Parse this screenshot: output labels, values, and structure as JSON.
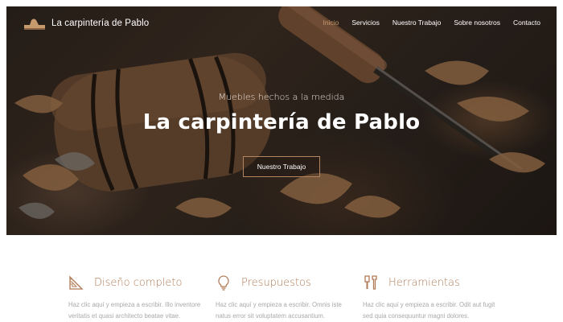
{
  "header": {
    "brand_name": "La carpintería de Pablo",
    "logo_icon": "hand-plane-icon",
    "menu": [
      {
        "label": "Inicio",
        "active": true
      },
      {
        "label": "Servicios",
        "active": false
      },
      {
        "label": "Nuestro Trabajo",
        "active": false
      },
      {
        "label": "Sobre nosotros",
        "active": false
      },
      {
        "label": "Contacto",
        "active": false
      }
    ]
  },
  "hero": {
    "subtitle": "Muebles hechos a la medida",
    "title": "La carpintería de Pablo",
    "button_label": "Nuestro Trabajo"
  },
  "features": [
    {
      "icon": "ruler-square-icon",
      "title": "Diseño completo",
      "text": "Haz clic aquí y empieza a escribir. Illo inventore veritatis et quasi architecto beatae vitae."
    },
    {
      "icon": "lightbulb-icon",
      "title": "Presupuestos",
      "text": "Haz clic aquí y empieza a escribir. Omnis iste natus error sit voluptatem accusantium."
    },
    {
      "icon": "tools-icon",
      "title": "Herramientas",
      "text": "Haz clic aquí y empieza a escribir. Odit aut fugit sed quia consequuntur magni dolores."
    }
  ],
  "colors": {
    "accent": "#b07a55",
    "active_menu": "#c69a6d",
    "body_text": "#a9a9a9"
  }
}
